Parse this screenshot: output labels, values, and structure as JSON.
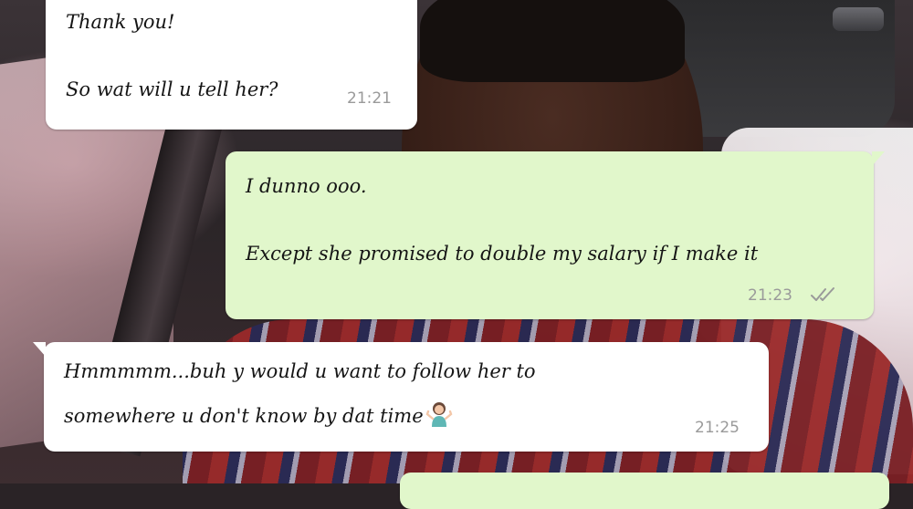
{
  "messages": [
    {
      "direction": "incoming",
      "lines": [
        "Thank you!",
        "So wat will u tell her?"
      ],
      "time": "21:21"
    },
    {
      "direction": "outgoing",
      "lines": [
        "I dunno ooo.",
        "Except she promised to double my salary if I make it"
      ],
      "time": "21:23",
      "status": "delivered-double-check"
    },
    {
      "direction": "incoming",
      "lines": [
        "Hmmmmm...buh y would u want to follow her to",
        "somewhere u don't know by dat time"
      ],
      "emoji": "person-shrugging",
      "time": "21:25"
    }
  ],
  "colors": {
    "incoming_bubble": "#ffffff",
    "outgoing_bubble": "#e1f7cb",
    "timestamp": "#9a9a9a",
    "tick": "#9a9a9a"
  },
  "icons": {
    "read_status": "double-check-icon",
    "emoji": "person-shrugging-emoji"
  }
}
